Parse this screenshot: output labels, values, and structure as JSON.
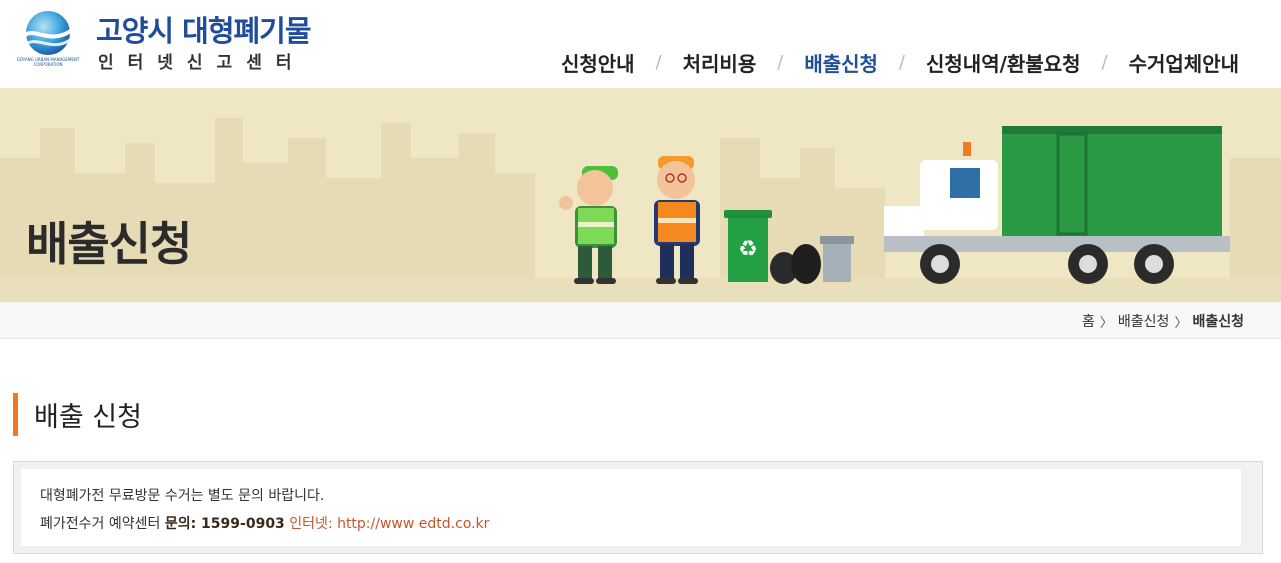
{
  "header": {
    "logo_title": "고양시 대형폐기물",
    "logo_subtitle": "인터넷신고센터",
    "logo_corp": "GOYANG URBAN MANAGEMENT CORPORATION"
  },
  "nav": {
    "items": [
      {
        "label": "신청안내"
      },
      {
        "label": "처리비용"
      },
      {
        "label": "배출신청"
      },
      {
        "label": "신청내역/환불요청"
      },
      {
        "label": "수거업체안내"
      }
    ],
    "separator": "/",
    "active_color": "#1e4f9b"
  },
  "banner": {
    "title": "배출신청",
    "background_color": "#efe6c4"
  },
  "breadcrumb": {
    "items": [
      "홈",
      "배출신청",
      "배출신청"
    ],
    "arrow": "〉"
  },
  "section": {
    "title": "배출 신청",
    "accent_color": "#ef7a16"
  },
  "notice": {
    "line1": "대형폐가전 무료방문 수거는 별도 문의 바랍니다.",
    "line2_prefix": "폐가전수거 예약센터 ",
    "line2_phone": "문의: 1599-0903",
    "line2_web": "인터넷: http://www edtd.co.kr"
  },
  "icons": [
    "logo-wave-icon",
    "recycle-icon",
    "home-icon"
  ]
}
